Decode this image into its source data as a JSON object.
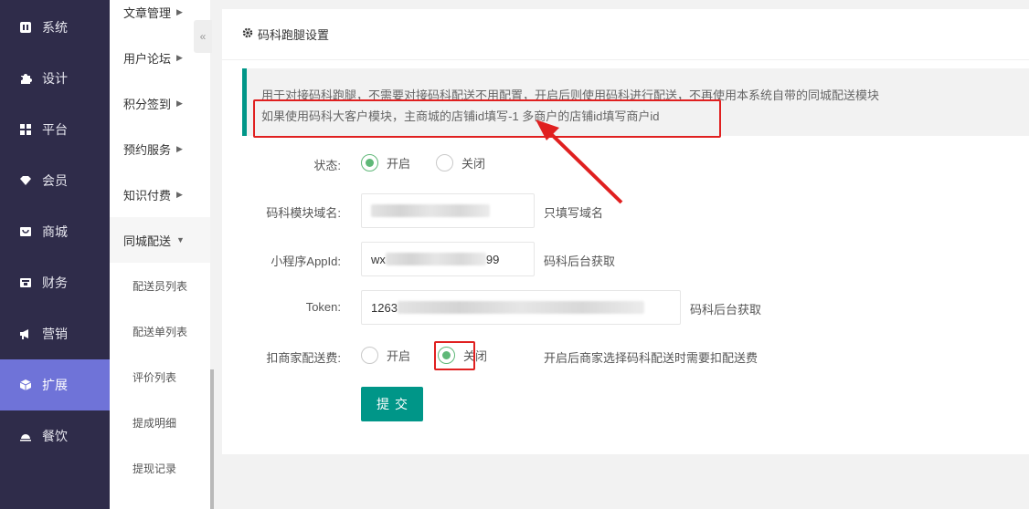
{
  "sidebar": {
    "items": [
      {
        "label": "系统",
        "icon": "system-icon"
      },
      {
        "label": "设计",
        "icon": "puzzle-icon"
      },
      {
        "label": "平台",
        "icon": "grid-icon"
      },
      {
        "label": "会员",
        "icon": "gem-icon"
      },
      {
        "label": "商城",
        "icon": "store-icon"
      },
      {
        "label": "财务",
        "icon": "wallet-icon"
      },
      {
        "label": "营销",
        "icon": "megaphone-icon"
      },
      {
        "label": "扩展",
        "icon": "cube-icon"
      },
      {
        "label": "餐饮",
        "icon": "dish-icon"
      }
    ],
    "active": "扩展",
    "accent": "#6f73d8"
  },
  "submenu": {
    "items": [
      "文章管理",
      "用户论坛",
      "积分签到",
      "预约服务",
      "知识付费",
      "同城配送"
    ],
    "open": "同城配送",
    "children": [
      "配送员列表",
      "配送单列表",
      "评价列表",
      "提成明细",
      "提现记录"
    ],
    "collapse_glyph": "«"
  },
  "card": {
    "title": "码科跑腿设置",
    "notice_line1": "用于对接码科跑腿，不需要对接码科配送不用配置，开启后则使用码科进行配送，不再使用本系统自带的同城配送模块",
    "notice_line2": "如果使用码科大客户模块，主商城的店铺id填写-1 多商户的店铺id填写商户id"
  },
  "form": {
    "status_label": "状态:",
    "status_on": "开启",
    "status_off": "关闭",
    "status_value": "开启",
    "domain_label": "码科模块域名:",
    "domain_hint": "只填写域名",
    "appid_label": "小程序AppId:",
    "appid_prefix": "wx",
    "appid_suffix": "99",
    "appid_hint": "码科后台获取",
    "token_label": "Token:",
    "token_prefix": "1263",
    "token_hint": "码科后台获取",
    "fee_label": "扣商家配送费:",
    "fee_on": "开启",
    "fee_off": "关闭",
    "fee_value": "关闭",
    "fee_hint": "开启后商家选择码科配送时需要扣配送费",
    "submit_label": "提交"
  },
  "colors": {
    "primary": "#009688",
    "radio_checked": "#5fb878",
    "annotation": "#e02020"
  }
}
